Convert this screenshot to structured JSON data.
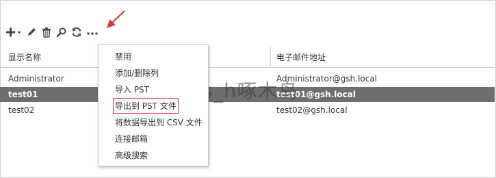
{
  "toolbar": {
    "icons": [
      "add-icon",
      "edit-icon",
      "delete-icon",
      "search-icon",
      "refresh-icon",
      "more-icon"
    ]
  },
  "columns": {
    "display_name": "显示名称",
    "email": "电子邮件地址"
  },
  "rows": [
    {
      "name": "Administrator",
      "email": "Administrator@gsh.local",
      "selected": false
    },
    {
      "name": "test01",
      "email": "test01@gsh.local",
      "selected": true
    },
    {
      "name": "test02",
      "email": "test02@gsh.local",
      "selected": false
    }
  ],
  "menu": {
    "items": [
      "禁用",
      "添加/删除列",
      "导入 PST",
      "导出到 PST 文件",
      "将数据导出到 CSV 文件",
      "连接邮箱",
      "高级搜索"
    ],
    "highlighted_index": 3
  },
  "watermark": "gs_h啄木鸟",
  "colors": {
    "selected_row_bg": "#6e6e6e",
    "annotation_red": "#d23a3a",
    "icon_dark": "#444444"
  }
}
